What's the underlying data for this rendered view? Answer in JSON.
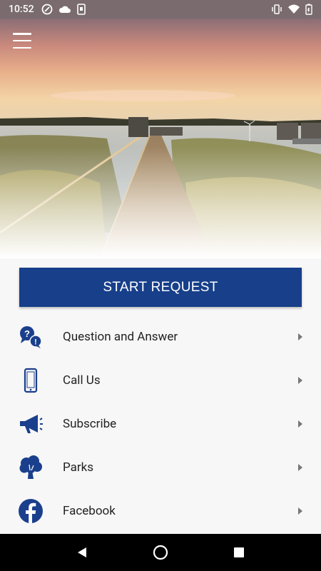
{
  "status_bar": {
    "time": "10:52"
  },
  "header": {
    "menu_icon": "hamburger-menu-icon"
  },
  "main": {
    "start_button_label": "START REQUEST",
    "items": [
      {
        "label": "Question and Answer",
        "icon": "question-answer-icon"
      },
      {
        "label": "Call Us",
        "icon": "phone-icon"
      },
      {
        "label": "Subscribe",
        "icon": "megaphone-icon"
      },
      {
        "label": "Parks",
        "icon": "tree-icon"
      },
      {
        "label": "Facebook",
        "icon": "facebook-icon"
      }
    ]
  },
  "colors": {
    "primary": "#173f8a",
    "icon": "#1a3f8c"
  }
}
